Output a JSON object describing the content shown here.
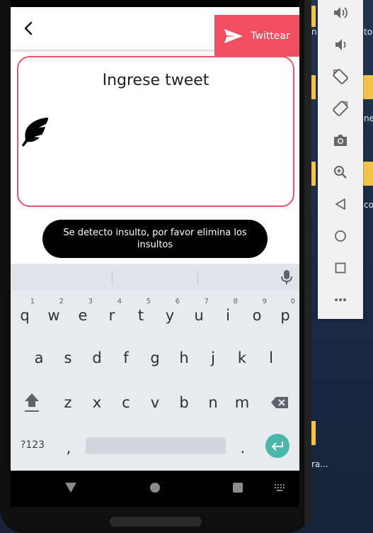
{
  "app": {
    "tweet_button_label": "Twittear",
    "input_placeholder": "Ingrese tweet",
    "toast_message": "Se detecto insulto, por favor elimina los insultos"
  },
  "keyboard": {
    "row1": [
      {
        "char": "q",
        "num": "1"
      },
      {
        "char": "w",
        "num": "2"
      },
      {
        "char": "e",
        "num": "3"
      },
      {
        "char": "r",
        "num": "4"
      },
      {
        "char": "t",
        "num": "5"
      },
      {
        "char": "y",
        "num": "6"
      },
      {
        "char": "u",
        "num": "7"
      },
      {
        "char": "i",
        "num": "8"
      },
      {
        "char": "o",
        "num": "9"
      },
      {
        "char": "p",
        "num": "0"
      }
    ],
    "row2": [
      "a",
      "s",
      "d",
      "f",
      "g",
      "h",
      "j",
      "k",
      "l"
    ],
    "row3": [
      "z",
      "x",
      "c",
      "v",
      "b",
      "n",
      "m"
    ],
    "symbols_label": "?123",
    "comma_label": ",",
    "period_label": "."
  },
  "desktop": {
    "fragments": [
      "n",
      "to",
      "ne",
      "co",
      "ra..."
    ]
  },
  "emulator_toolbar": {
    "buttons": [
      "volume-up-icon",
      "volume-down-icon",
      "rotate-left-icon",
      "rotate-right-icon",
      "camera-icon",
      "zoom-icon",
      "back-icon",
      "home-icon",
      "overview-icon",
      "more-icon"
    ]
  },
  "colors": {
    "accent": "#f04f62",
    "editor_border": "#e8536a",
    "enter_key": "#4db6ac"
  }
}
